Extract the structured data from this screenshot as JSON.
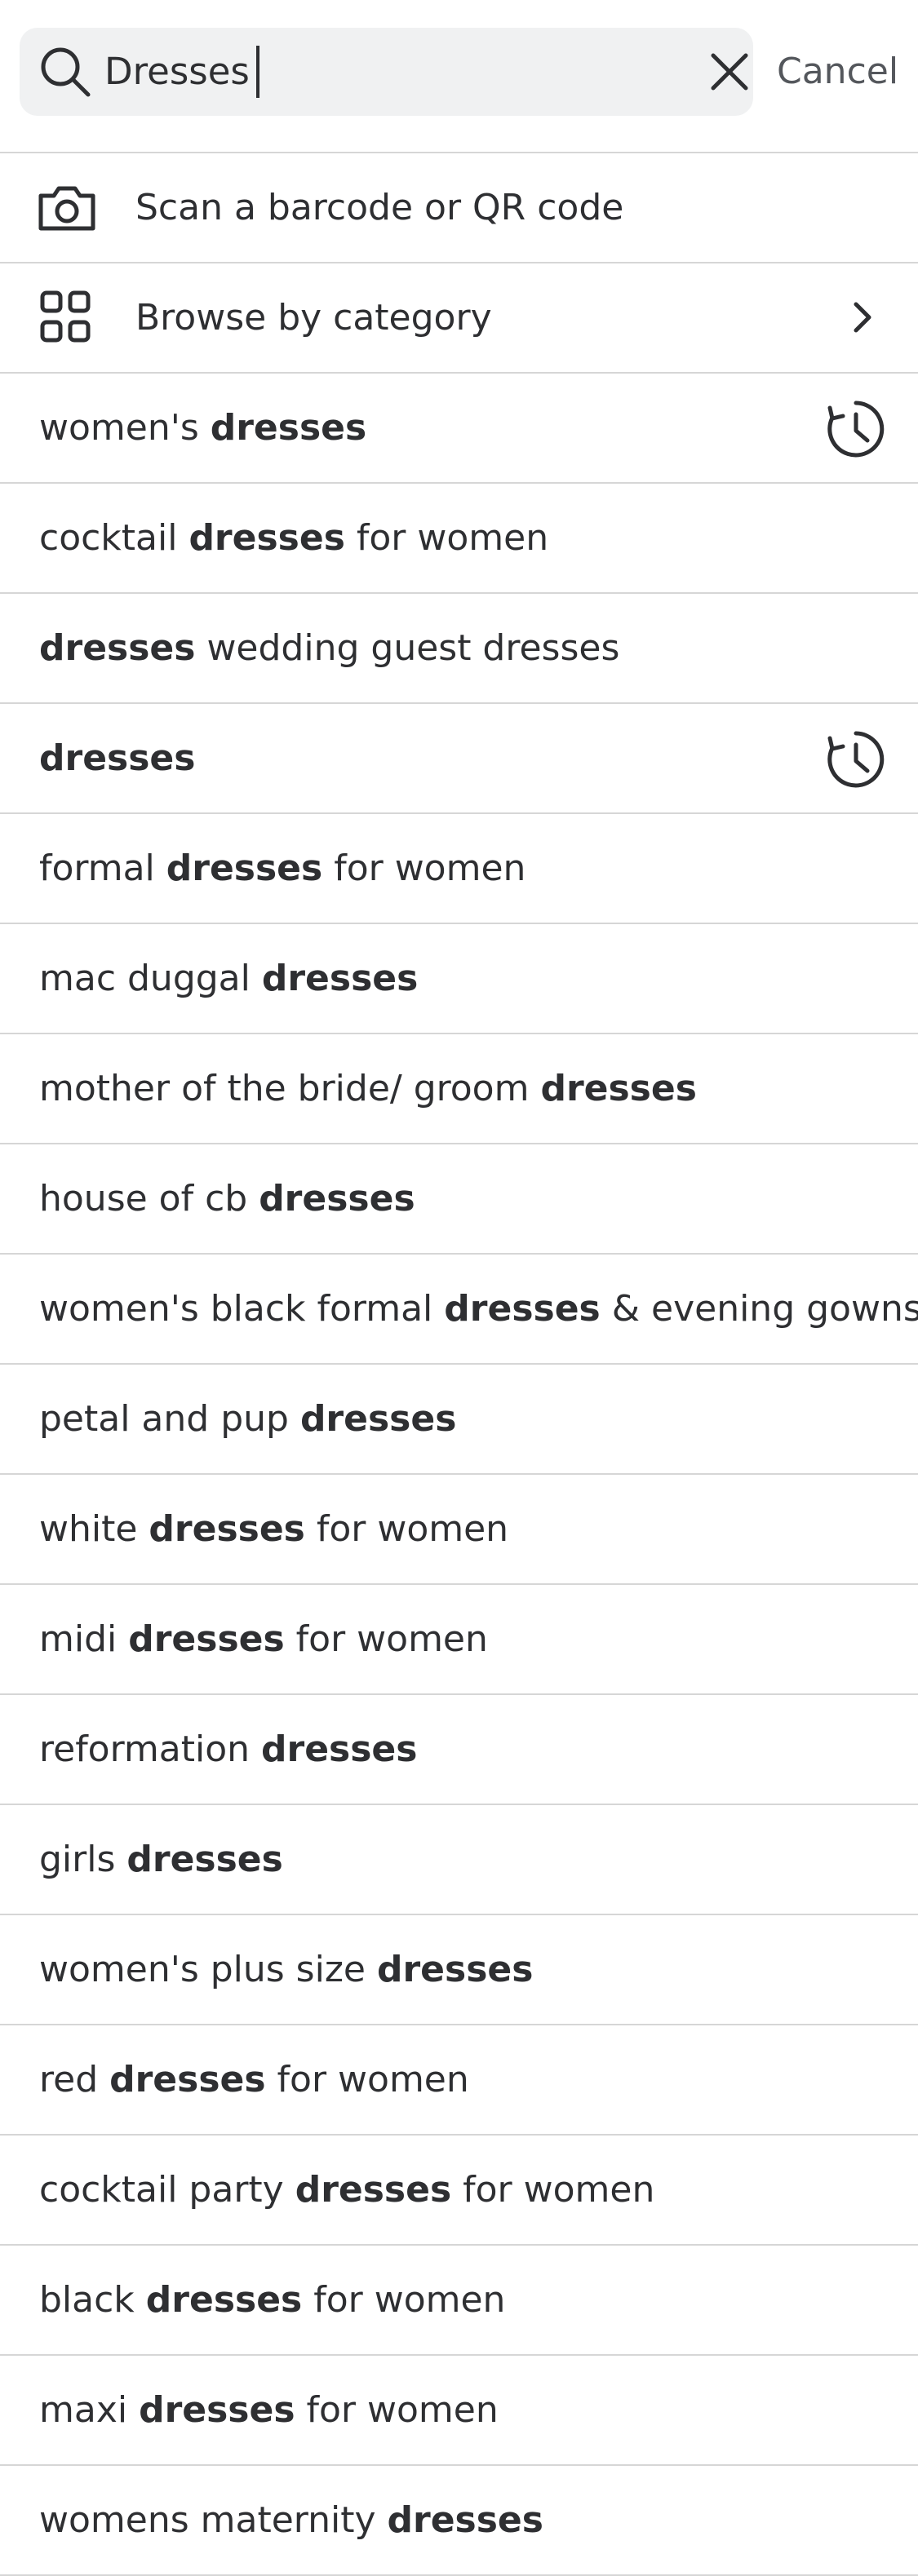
{
  "search": {
    "value": "Dresses",
    "cancel_label": "Cancel"
  },
  "actions": [
    {
      "label": "Scan a barcode or QR code",
      "icon": "camera-icon"
    },
    {
      "label": "Browse by category",
      "icon": "grid-icon",
      "trailing_icon": "chevron-right-icon"
    }
  ],
  "suggestions": [
    {
      "before": "women's ",
      "bold": "dresses",
      "after": "",
      "recent": true
    },
    {
      "before": "cocktail ",
      "bold": "dresses",
      "after": " for women",
      "recent": false
    },
    {
      "before": "",
      "bold": "dresses",
      "after": " wedding guest dresses",
      "recent": false
    },
    {
      "before": "",
      "bold": "dresses",
      "after": "",
      "recent": true
    },
    {
      "before": "formal ",
      "bold": "dresses",
      "after": " for women",
      "recent": false
    },
    {
      "before": "mac duggal ",
      "bold": "dresses",
      "after": "",
      "recent": false
    },
    {
      "before": "mother of the bride/ groom ",
      "bold": "dresses",
      "after": "",
      "recent": false
    },
    {
      "before": "house of cb ",
      "bold": "dresses",
      "after": "",
      "recent": false
    },
    {
      "before": "women's black formal ",
      "bold": "dresses",
      "after": " & evening gowns",
      "recent": false
    },
    {
      "before": "petal and pup ",
      "bold": "dresses",
      "after": "",
      "recent": false
    },
    {
      "before": "white ",
      "bold": "dresses",
      "after": " for women",
      "recent": false
    },
    {
      "before": "midi ",
      "bold": "dresses",
      "after": " for women",
      "recent": false
    },
    {
      "before": "reformation ",
      "bold": "dresses",
      "after": "",
      "recent": false
    },
    {
      "before": "girls ",
      "bold": "dresses",
      "after": "",
      "recent": false
    },
    {
      "before": "women's plus size ",
      "bold": "dresses",
      "after": "",
      "recent": false
    },
    {
      "before": "red ",
      "bold": "dresses",
      "after": " for women",
      "recent": false
    },
    {
      "before": "cocktail party ",
      "bold": "dresses",
      "after": " for women",
      "recent": false
    },
    {
      "before": "black ",
      "bold": "dresses",
      "after": " for women",
      "recent": false
    },
    {
      "before": "maxi ",
      "bold": "dresses",
      "after": " for women",
      "recent": false
    },
    {
      "before": "womens maternity ",
      "bold": "dresses",
      "after": "",
      "recent": false
    }
  ]
}
